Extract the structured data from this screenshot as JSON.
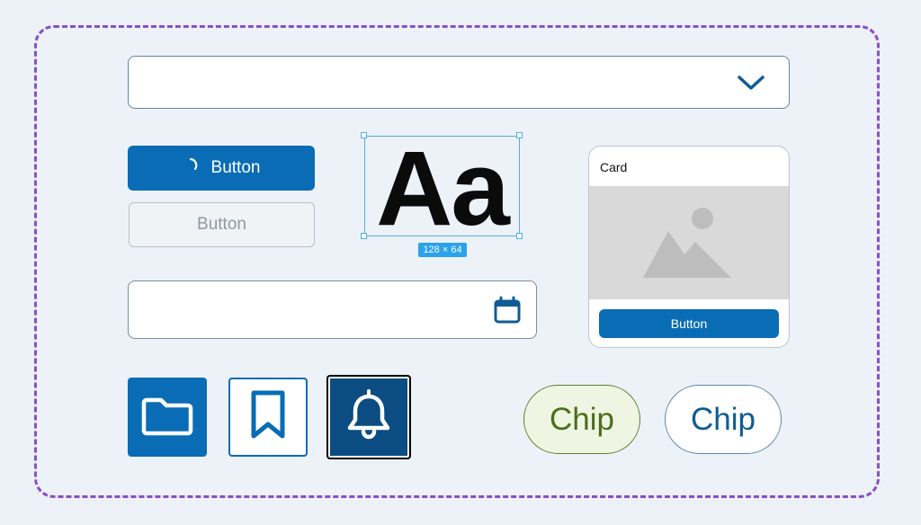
{
  "colors": {
    "background": "#edf1f8",
    "frame_dash": "#8a4fc9",
    "primary": "#0a6cb4",
    "primary_dark": "#0b4c82",
    "selection": "#4fb0e6",
    "chip_green_bg": "#eff5e3",
    "chip_green_text": "#4c6f19"
  },
  "select": {
    "value": "",
    "icon": "chevron-down-icon"
  },
  "buttons": {
    "primary_loading_label": "Button",
    "disabled_label": "Button"
  },
  "type_sample": {
    "glyph": "Aa",
    "dimensions": "128 × 64"
  },
  "date_field": {
    "value": "",
    "icon": "calendar-icon"
  },
  "card": {
    "title": "Card",
    "media_icon": "image-placeholder-icon",
    "button_label": "Button"
  },
  "icon_buttons": [
    {
      "icon": "folder-icon",
      "style": "filled"
    },
    {
      "icon": "bookmark-icon",
      "style": "outlined"
    },
    {
      "icon": "bell-icon",
      "style": "filled-focused"
    }
  ],
  "chips": [
    {
      "label": "Chip",
      "style": "green"
    },
    {
      "label": "Chip",
      "style": "outline"
    }
  ]
}
